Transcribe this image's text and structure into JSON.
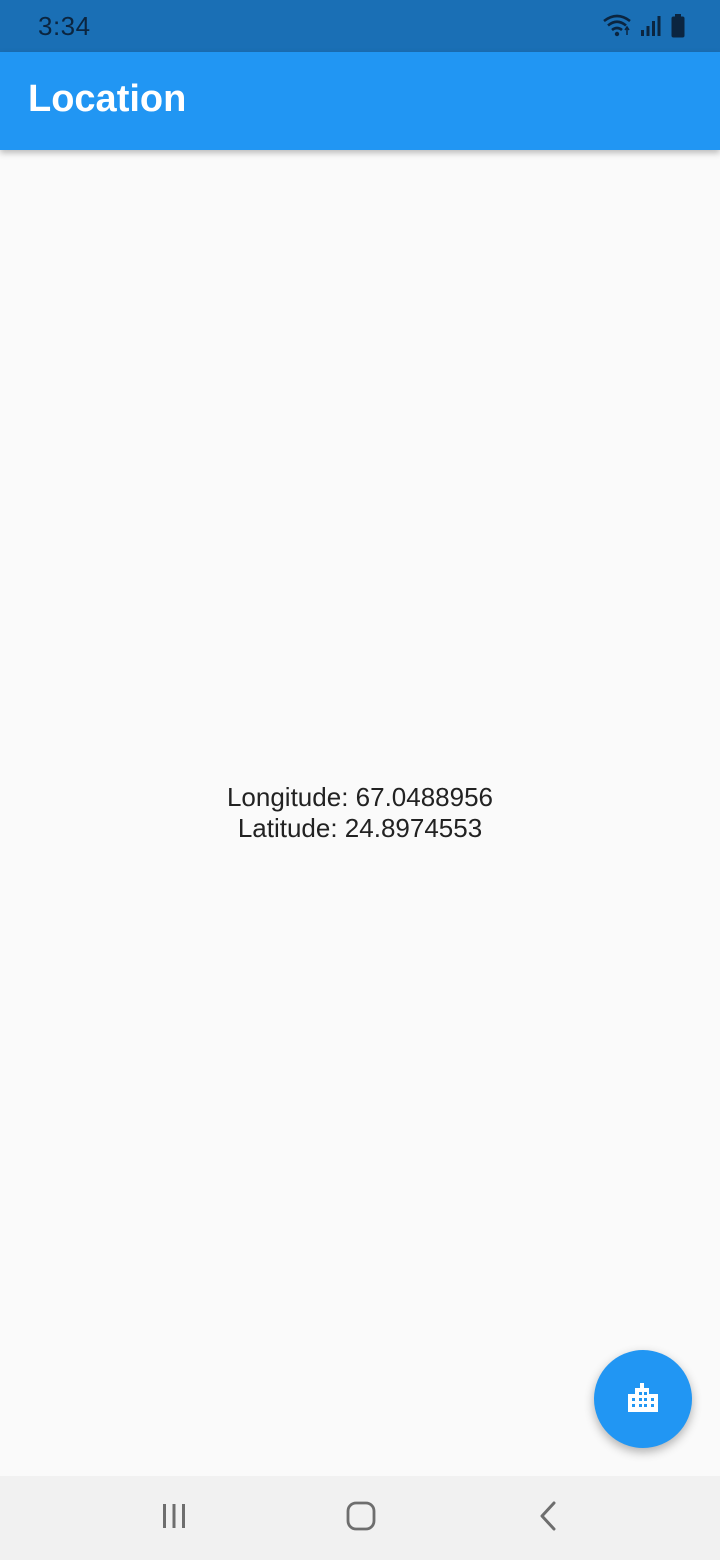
{
  "status_bar": {
    "time": "3:34",
    "icons": [
      "wifi-icon",
      "signal-icon",
      "battery-icon"
    ]
  },
  "app_bar": {
    "title": "Location"
  },
  "location": {
    "longitude_label": "Longitude:",
    "longitude_value": "67.0488956",
    "latitude_label": "Latitude:",
    "latitude_value": "24.8974553"
  },
  "fab": {
    "icon": "building-icon"
  },
  "nav_bar": {
    "buttons": [
      "recent-apps-icon",
      "home-icon",
      "back-icon"
    ]
  },
  "colors": {
    "status_bar": "#1a6fb5",
    "primary": "#2196f3",
    "background": "#fafafa",
    "nav_bar": "#f1f1f1",
    "text": "#222222"
  }
}
